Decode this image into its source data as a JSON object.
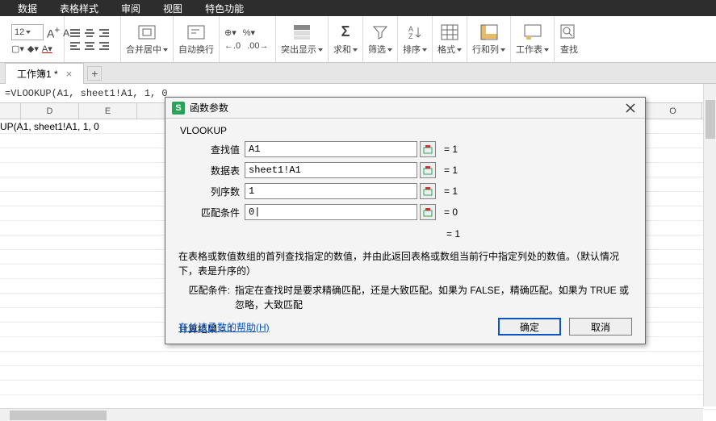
{
  "menu": {
    "items": [
      "数据",
      "表格样式",
      "审阅",
      "视图",
      "特色功能"
    ]
  },
  "ribbon": {
    "fontsize": "12",
    "merge_label": "合并居中",
    "wrap_label": "自动换行",
    "highlight": "突出显示",
    "sum": "求和",
    "filter": "筛选",
    "sort": "排序",
    "format": "格式",
    "rowcol": "行和列",
    "worksheet": "工作表",
    "find": "查找"
  },
  "tabs": {
    "sheet1": "工作簿1 *",
    "plus": "+"
  },
  "formula_bar": "=VLOOKUP(A1, sheet1!A1, 1, 0",
  "grid": {
    "cols": [
      "",
      "D",
      "E",
      "",
      "",
      "",
      "",
      "",
      "",
      "",
      "",
      "O"
    ],
    "a1": "UP(A1, sheet1!A1, 1, 0"
  },
  "dialog": {
    "title": "函数参数",
    "func": "VLOOKUP",
    "params": [
      {
        "label": "查找值",
        "value": "A1",
        "result": "= 1"
      },
      {
        "label": "数据表",
        "value": "sheet1!A1",
        "result": "= 1"
      },
      {
        "label": "列序数",
        "value": "1",
        "result": "= 1"
      },
      {
        "label": "匹配条件",
        "value": "0|",
        "result": "= 0"
      }
    ],
    "mid_result": "= 1",
    "desc": "在表格或数值数组的首列查找指定的数值，并由此返回表格或数组当前行中指定列处的数值。（默认情况下，表是升序的）",
    "desc2_label": "匹配条件:",
    "desc2_text": "指定在查找时是要求精确匹配，还是大致匹配。如果为 FALSE，精确匹配。如果为 TRUE 或忽略，大致匹配",
    "calc_result": "计算结果 = 1",
    "help": "有关该函数的帮助(H)",
    "ok": "确定",
    "cancel": "取消"
  }
}
